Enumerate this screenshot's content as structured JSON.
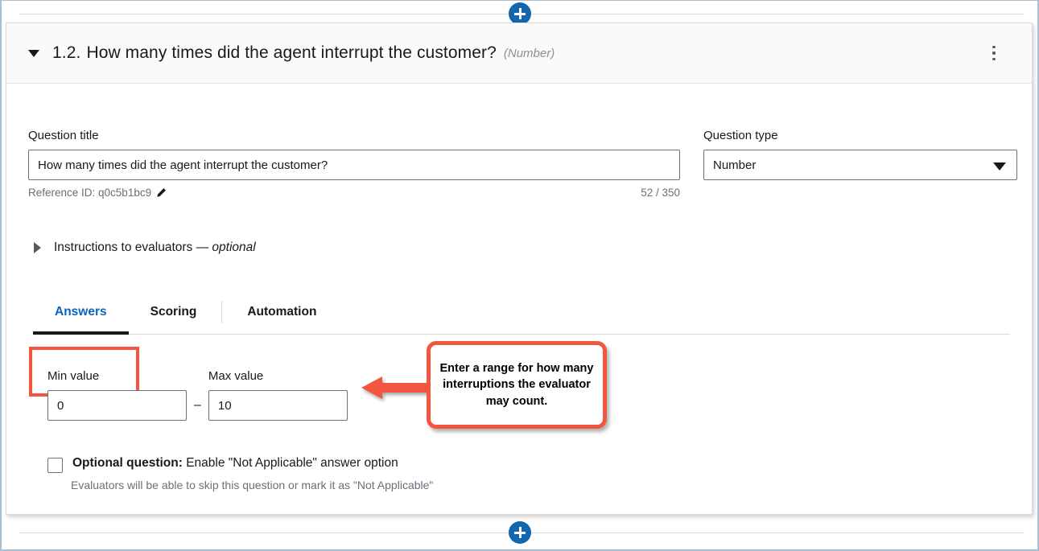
{
  "header": {
    "collapse_icon": "caret-down-icon",
    "number": "1.2.",
    "title": "How many times did the agent interrupt the customer?",
    "type_hint": "(Number)",
    "menu_icon": "kebab-menu-icon"
  },
  "add_buttons": {
    "top_label": "+",
    "bottom_label": "+",
    "icon": "plus-icon"
  },
  "question_title": {
    "label": "Question title",
    "value": "How many times did the agent interrupt the customer?",
    "placeholder": "Enter question title",
    "reference_id_label": "Reference ID: q0c5b1bc9",
    "edit_icon": "pencil-icon",
    "char_count": "52 / 350"
  },
  "question_type": {
    "label": "Question type",
    "value": "Number",
    "caret_icon": "caret-down-icon",
    "options": [
      "Number"
    ]
  },
  "instructions": {
    "caret_icon": "caret-right-icon",
    "label": "Instructions to evaluators — ",
    "optional_word": "optional"
  },
  "tabs": {
    "items": [
      {
        "label": "Answers",
        "active": true
      },
      {
        "label": "Scoring",
        "active": false
      },
      {
        "label": "Automation",
        "active": false
      }
    ]
  },
  "answers_panel": {
    "min": {
      "label": "Min value",
      "value": "0",
      "placeholder": ""
    },
    "separator": "–",
    "max": {
      "label": "Max value",
      "value": "10",
      "placeholder": ""
    },
    "optional_question": {
      "checked": false,
      "strong_label": "Optional question:",
      "label": " Enable \"Not Applicable\" answer option",
      "description": "Evaluators will be able to skip this question or mark it as \"Not Applicable\""
    }
  },
  "annotation": {
    "text": "Enter a range for how many interruptions the evaluator may count.",
    "arrow_icon": "left-arrow-icon"
  },
  "colors": {
    "accent_blue": "#0a62c1",
    "add_button_blue": "#1166ad",
    "annotation_red": "#f4553f",
    "text_primary": "#16191f",
    "text_secondary": "#687078",
    "border": "#687078",
    "divider": "#d5dbdb",
    "header_bg": "#fafafa"
  }
}
